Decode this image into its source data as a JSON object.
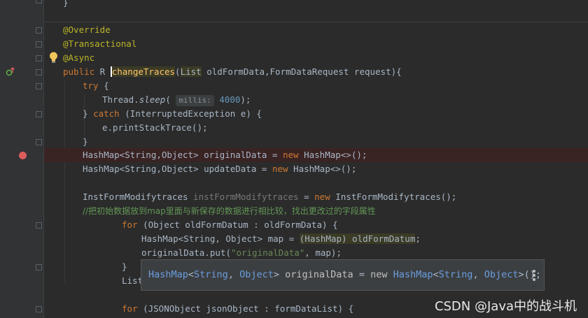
{
  "editor": {
    "lines": [
      {
        "t": "}"
      },
      {
        "t": "@Override"
      },
      {
        "t": "@Transactional"
      },
      {
        "t": "@Async"
      },
      {
        "t": "public R changeTraces(List oldFormData,FormDataRequest request){"
      },
      {
        "t": "try {"
      },
      {
        "t": "Thread.sleep("
      },
      {
        "t": "millis:"
      },
      {
        "t": "4000"
      },
      {
        "t": "} catch (InterruptedException e) {"
      },
      {
        "t": "e.printStackTrace();"
      },
      {
        "t": "}"
      },
      {
        "t": "HashMap<String,Object> originalData = new HashMap<>();"
      },
      {
        "t": "HashMap<String,Object> updateData = new HashMap<>();"
      },
      {
        "t": "InstFormModifytraces instFormModifytraces = new InstFormModifytraces();"
      },
      {
        "t": "//把初始数据放到map里面与新保存的数据进行相比较，找出更改过的字段属性"
      },
      {
        "t": "for (Object oldFormDatum : oldFormData) {"
      },
      {
        "t": "HashMap<String, Object> map = (HashMap) oldFormDatum;"
      },
      {
        "t": "originalData.put(\"originalData\", map);"
      },
      {
        "t": "}"
      },
      {
        "t": "List"
      },
      {
        "t": "for (JSONObject jsonObject : formDataList) {"
      }
    ]
  },
  "tooltip": {
    "text": "HashMap<String, Object> originalData = new HashMap<String, Object>();"
  },
  "watermark": "CSDN @Java中的战斗机",
  "colors": {
    "background": "#2b2b2b",
    "keyword": "#cc7832",
    "annotation": "#bbb529",
    "method": "#ffc66d",
    "number": "#6897bb",
    "string": "#6a8759",
    "breakpoint": "#db5c5c"
  }
}
